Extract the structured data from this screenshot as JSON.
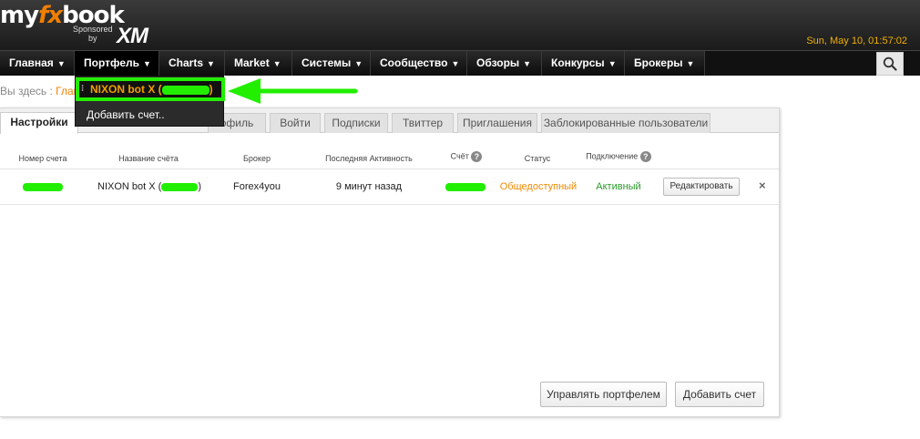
{
  "header": {
    "logo_my": "my",
    "logo_fx": "fx",
    "logo_book": "book",
    "sponsored": "Sponsored",
    "by": "by",
    "sponsor_brand": "XM",
    "datetime": "Sun, May 10, 01:57:02"
  },
  "nav": {
    "items": [
      {
        "label": "Главная"
      },
      {
        "label": "Портфель"
      },
      {
        "label": "Charts"
      },
      {
        "label": "Market"
      },
      {
        "label": "Системы"
      },
      {
        "label": "Сообщество"
      },
      {
        "label": "Обзоры"
      },
      {
        "label": "Конкурсы"
      },
      {
        "label": "Брокеры"
      }
    ],
    "search_icon": "search-icon"
  },
  "breadcrumb": {
    "prefix": "Вы здесь :",
    "link": "Глав"
  },
  "dropdown": {
    "account_label": "NIXON bot X (",
    "account_suffix": ")",
    "add_account": "Добавить счет.."
  },
  "tabs": [
    "Настройки",
    "",
    "офиль",
    "Войти",
    "Подписки",
    "Твиттер",
    "Приглашения",
    "Заблокированные пользователи"
  ],
  "table": {
    "headers": {
      "account_number": "Номер счета",
      "account_name": "Название счёта",
      "broker": "Брокер",
      "last_activity": "Последняя Активность",
      "score": "Счёт",
      "status": "Статус",
      "connection": "Подключение"
    },
    "row": {
      "account_name": "NIXON bot X (",
      "account_name_suffix": ")",
      "broker": "Forex4you",
      "last_activity": "9 минут назад",
      "status": "Общедоступный",
      "connection": "Активный",
      "edit": "Редактировать",
      "remove": "×"
    }
  },
  "buttons": {
    "manage_portfolio": "Управлять портфелем",
    "add_account": "Добавить счет"
  },
  "colors": {
    "accent": "#f07f00",
    "highlight": "#22ee00",
    "active_status": "#2a9a2a"
  }
}
